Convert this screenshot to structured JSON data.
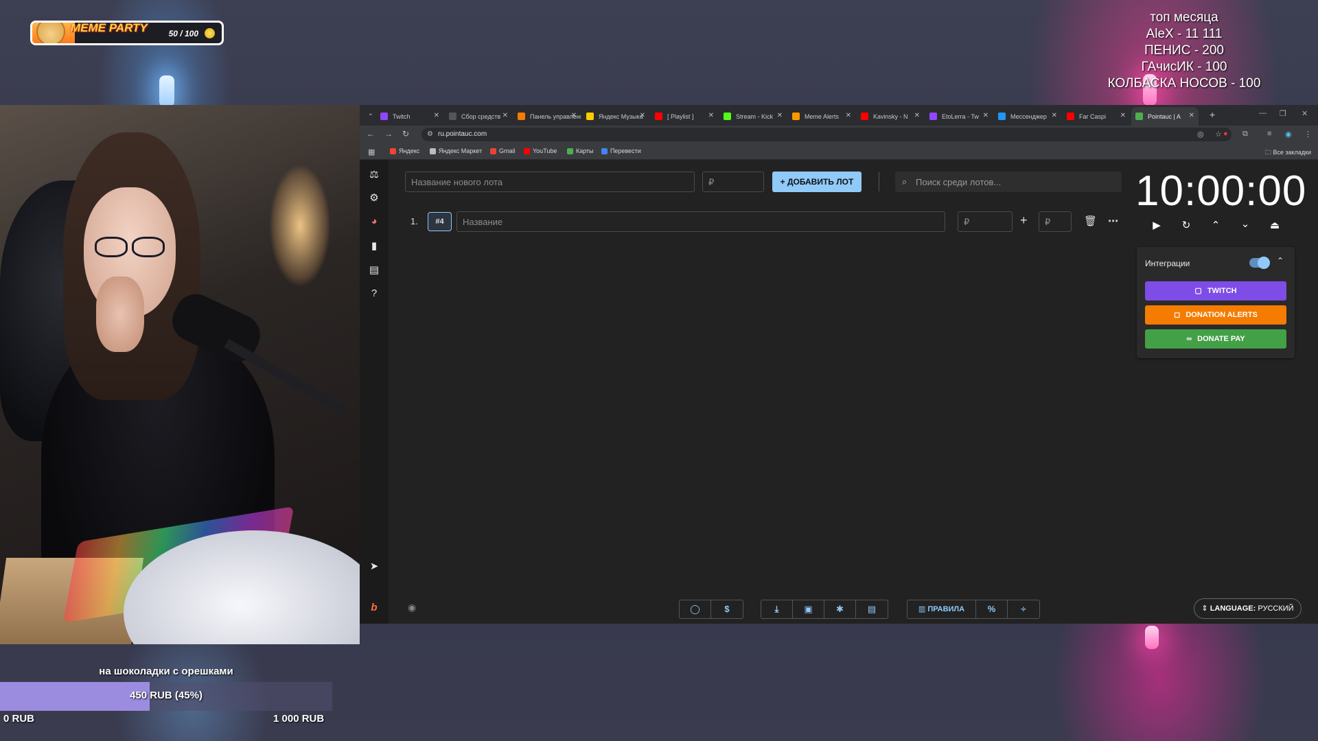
{
  "meme_widget": {
    "title": "MEME PARTY",
    "count": "50 / 100",
    "progress": 0.5
  },
  "top_month": {
    "title": "топ месяца",
    "entries": [
      "AleX - 11 111",
      "ПЕНИС - 200",
      "ГАчисИК - 100",
      "КОЛБАСКА НОСОВ - 100"
    ]
  },
  "goal": {
    "title": "на шоколадки с орешками",
    "current_text": "450 RUB (45%)",
    "progress": 0.45,
    "min": "0 RUB",
    "max": "1 000 RUB"
  },
  "browser": {
    "tabs": [
      {
        "label": "Twitch",
        "color": "#9146ff"
      },
      {
        "label": "Сбор средств",
        "color": "#555555"
      },
      {
        "label": "Панель управления",
        "color": "#f57c00"
      },
      {
        "label": "Яндекс Музыка",
        "color": "#ffcc00"
      },
      {
        "label": "[ Playlist ]",
        "color": "#ff0000"
      },
      {
        "label": "Stream - Kick",
        "color": "#53fc18"
      },
      {
        "label": "Meme Alerts",
        "color": "#ff9800"
      },
      {
        "label": "Kavinsky - N",
        "color": "#ff0000"
      },
      {
        "label": "EtoLerra - Tw",
        "color": "#9146ff"
      },
      {
        "label": "Мессенджер",
        "color": "#2196f3"
      },
      {
        "label": "Far Caspi",
        "color": "#ff0000"
      },
      {
        "label": "Pointauc | A",
        "color": "#4caf50"
      }
    ],
    "url": "ru.pointauc.com",
    "bookmarks": [
      {
        "label": "Яндекс",
        "color": "#f44336"
      },
      {
        "label": "Яндекс Маркет",
        "color": "#bbbbbb"
      },
      {
        "label": "Gmail",
        "color": "#ea4335"
      },
      {
        "label": "YouTube",
        "color": "#ff0000"
      },
      {
        "label": "Карты",
        "color": "#4caf50"
      },
      {
        "label": "Перевести",
        "color": "#4285f4"
      }
    ],
    "all_bookmarks": "Все закладки"
  },
  "app": {
    "new_lot_placeholder": "Название нового лота",
    "amount_placeholder": "₽",
    "add_lot_label": "ДОБАВИТЬ ЛОТ",
    "search_placeholder": "Поиск среди лотов...",
    "lot": {
      "index": "1.",
      "id": "#4",
      "name_placeholder": "Название",
      "amount_placeholder": "₽",
      "add_placeholder": "₽"
    },
    "timer": "10:00:00",
    "integrations": {
      "label": "Интеграции",
      "enabled": true,
      "buttons": [
        {
          "label": "TWITCH",
          "color": "#7e4ce6"
        },
        {
          "label": "DONATION ALERTS",
          "color": "#f57c00"
        },
        {
          "label": "DONATE PAY",
          "color": "#43a047"
        }
      ]
    },
    "rules_label": "ПРАВИЛА",
    "language_label": "LANGUAGE:",
    "language_value": "РУССКИЙ"
  }
}
